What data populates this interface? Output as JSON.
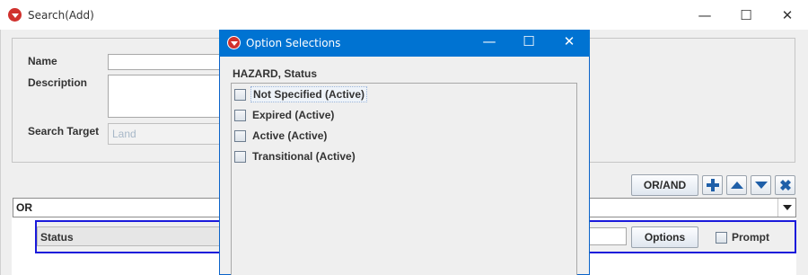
{
  "main_window": {
    "title": "Search(Add)",
    "controls": {
      "minimize": "—",
      "maximize": "☐",
      "close": "✕"
    }
  },
  "form": {
    "name_label": "Name",
    "description_label": "Description",
    "search_target_label": "Search Target",
    "search_target_value": "Land"
  },
  "toolbar": {
    "or_and_label": "OR/AND"
  },
  "condition": {
    "operator_value": "OR",
    "row_label": "Status",
    "options_label": "Options",
    "prompt_label": "Prompt"
  },
  "dialog": {
    "title": "Option Selections",
    "heading": "HAZARD, Status",
    "options": [
      {
        "label": "Not Specified (Active)",
        "checked": false,
        "focused": true
      },
      {
        "label": "Expired (Active)",
        "checked": false,
        "focused": false
      },
      {
        "label": "Active (Active)",
        "checked": false,
        "focused": false
      },
      {
        "label": "Transitional (Active)",
        "checked": false,
        "focused": false
      }
    ]
  },
  "colors": {
    "dialog_titlebar": "#0073d2",
    "selection_border": "#1a1adb",
    "app_icon": "#d0312d",
    "icon_button_glyph": "#1f5fa8"
  }
}
